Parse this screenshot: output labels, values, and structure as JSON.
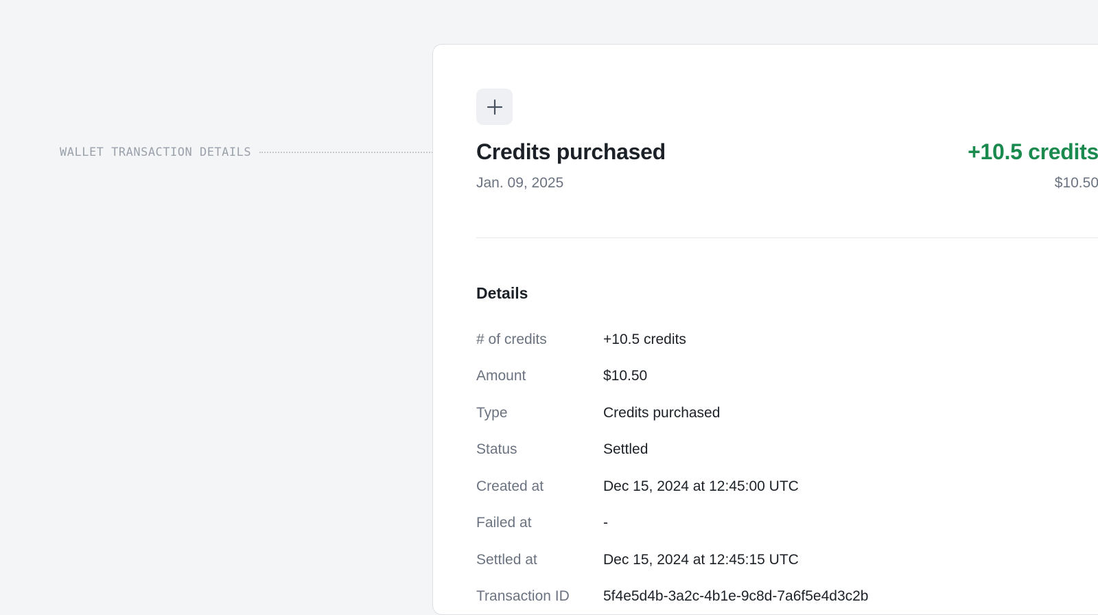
{
  "annotation": {
    "label": "WALLET TRANSACTION DETAILS"
  },
  "transaction": {
    "icon": "plus-icon",
    "title": "Credits purchased",
    "date": "Jan. 09, 2025",
    "credits": "+10.5 credits",
    "amount": "$10.50"
  },
  "details": {
    "heading": "Details",
    "rows": [
      {
        "label": "# of credits",
        "value": "+10.5 credits"
      },
      {
        "label": "Amount",
        "value": "$10.50"
      },
      {
        "label": "Type",
        "value": "Credits purchased"
      },
      {
        "label": "Status",
        "value": "Settled"
      },
      {
        "label": "Created at",
        "value": "Dec 15, 2024 at 12:45:00 UTC"
      },
      {
        "label": "Failed at",
        "value": "-"
      },
      {
        "label": "Settled at",
        "value": "Dec 15, 2024 at 12:45:15 UTC"
      },
      {
        "label": "Transaction ID",
        "value": "5f4e5d4b-3a2c-4b1e-9c8d-7a6f5e4d3c2b"
      }
    ]
  },
  "colors": {
    "background": "#f4f5f7",
    "panel": "#ffffff",
    "positive": "#1a8a4f",
    "muted": "#6b7380",
    "text": "#1c2128"
  }
}
